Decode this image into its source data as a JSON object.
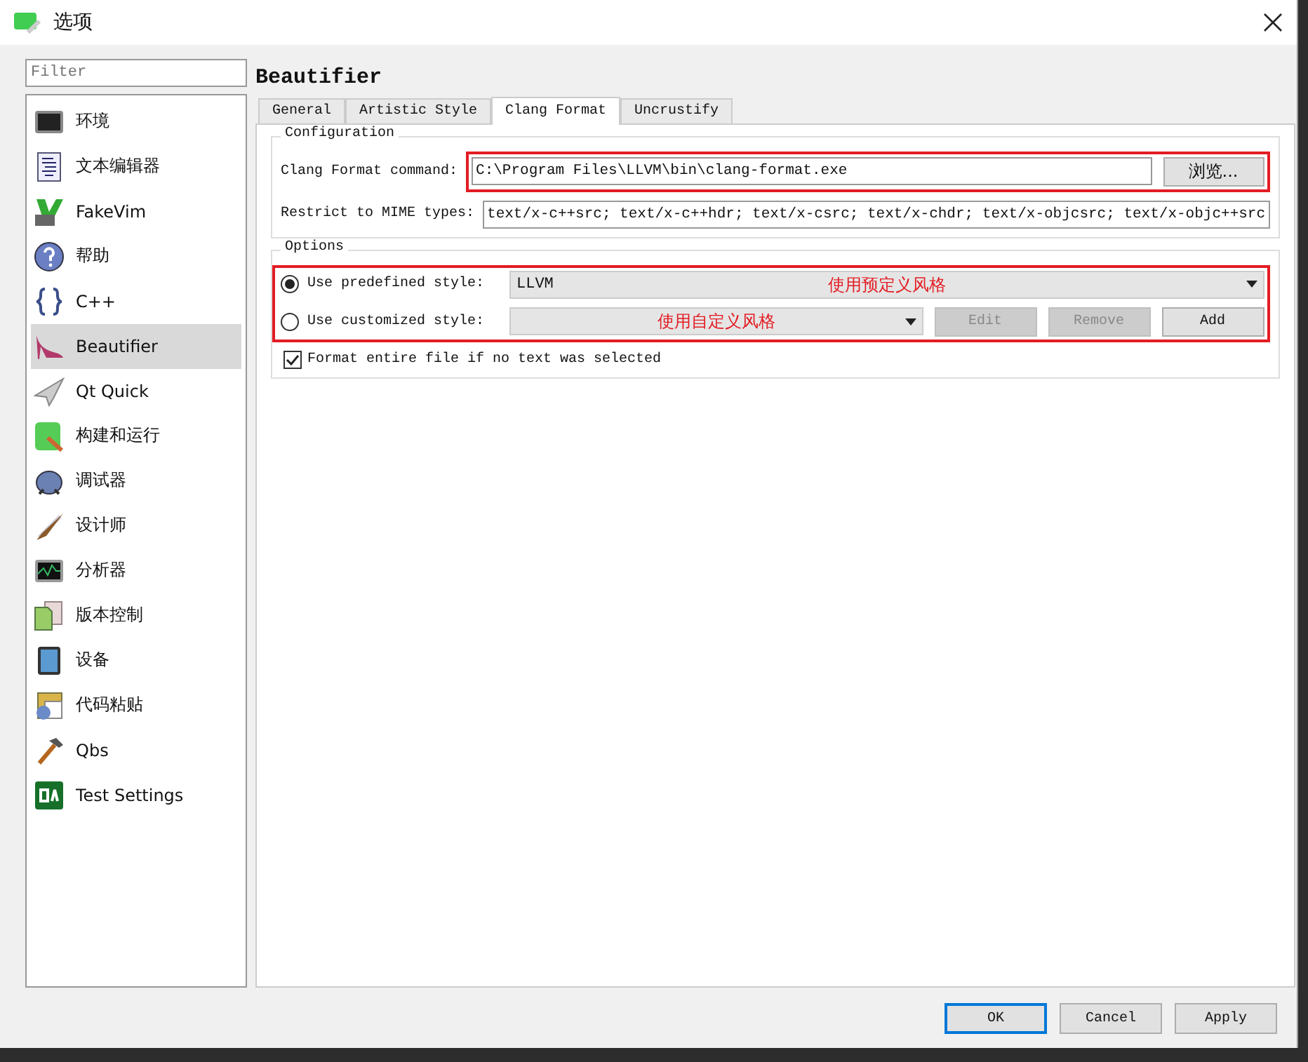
{
  "window": {
    "title": "选项"
  },
  "sidebar": {
    "filter": {
      "placeholder": "Filter"
    },
    "items": [
      {
        "label": "环境",
        "selected": false
      },
      {
        "label": "文本编辑器",
        "selected": false
      },
      {
        "label": "FakeVim",
        "selected": false
      },
      {
        "label": "帮助",
        "selected": false
      },
      {
        "label": "C++",
        "selected": false
      },
      {
        "label": "Beautifier",
        "selected": true
      },
      {
        "label": "Qt Quick",
        "selected": false
      },
      {
        "label": "构建和运行",
        "selected": false
      },
      {
        "label": "调试器",
        "selected": false
      },
      {
        "label": "设计师",
        "selected": false
      },
      {
        "label": "分析器",
        "selected": false
      },
      {
        "label": "版本控制",
        "selected": false
      },
      {
        "label": "设备",
        "selected": false
      },
      {
        "label": "代码粘贴",
        "selected": false
      },
      {
        "label": "Qbs",
        "selected": false
      },
      {
        "label": "Test Settings",
        "selected": false
      }
    ]
  },
  "page_title": "Beautifier",
  "tabs": [
    {
      "label": "General",
      "selected": false
    },
    {
      "label": "Artistic Style",
      "selected": false
    },
    {
      "label": "Clang Format",
      "selected": true
    },
    {
      "label": "Uncrustify",
      "selected": false
    }
  ],
  "configuration": {
    "title": "Configuration",
    "command": {
      "label": "Clang Format command:",
      "value": "C:\\Program Files\\LLVM\\bin\\clang-format.exe",
      "browse": "浏览...",
      "highlighted": true
    },
    "mime": {
      "label": "Restrict to MIME types:",
      "value": "text/x-c++src; text/x-c++hdr; text/x-csrc; text/x-chdr; text/x-objcsrc; text/x-objc++src"
    }
  },
  "options": {
    "title": "Options",
    "highlighted": true,
    "rows": [
      {
        "label": "Use predefined style:",
        "selected": true,
        "combo": "LLVM",
        "annotation": "使用预定义风格"
      },
      {
        "label": "Use customized style:",
        "selected": false,
        "annotation": "使用自定义风格",
        "buttons": [
          {
            "label": "Edit",
            "disabled": true
          },
          {
            "label": "Remove",
            "disabled": true
          },
          {
            "label": "Add",
            "disabled": false
          }
        ]
      }
    ],
    "format_entire": {
      "label": "Format entire file if no text was selected",
      "checked": true
    }
  },
  "buttons": [
    {
      "label": "OK",
      "default": true
    },
    {
      "label": "Cancel",
      "default": false
    },
    {
      "label": "Apply",
      "default": false
    }
  ]
}
